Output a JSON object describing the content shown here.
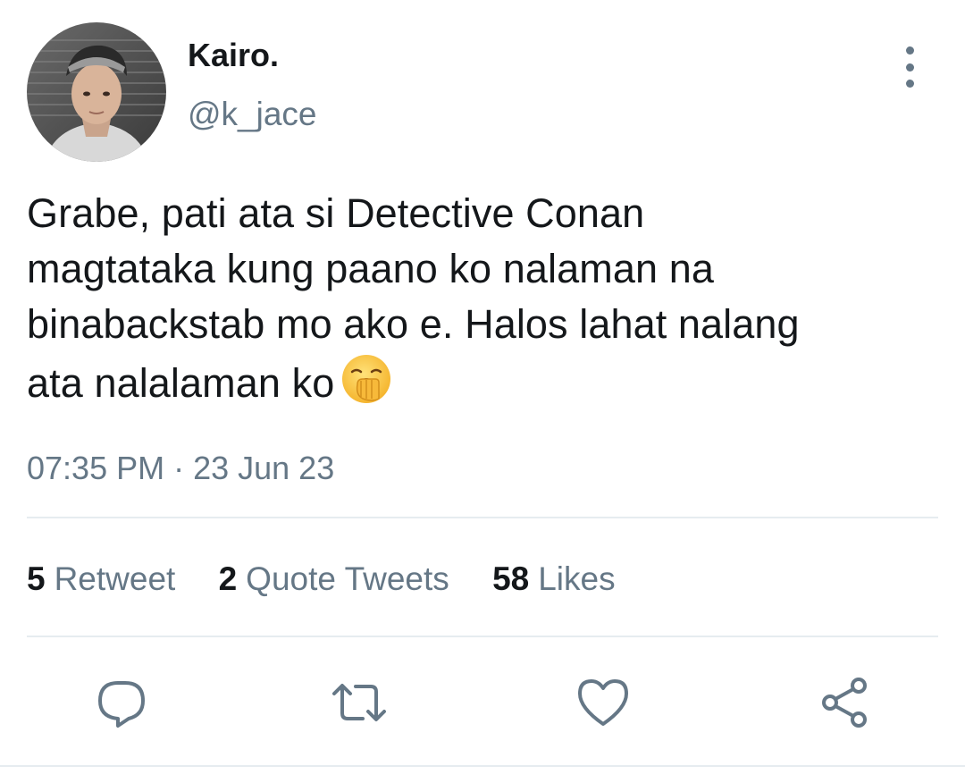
{
  "user": {
    "display_name": "Kairo.",
    "handle": "@k_jace"
  },
  "tweet": {
    "lines": [
      "Grabe, pati ata si Detective Conan",
      "magtataka kung paano ko nalaman na",
      "binabackstab mo ako e. Halos lahat nalang",
      "ata nalalaman ko"
    ],
    "emoji": "yawning-face-emoji",
    "timestamp": "07:35 PM · 23 Jun 23"
  },
  "stats": {
    "retweets": {
      "count": "5",
      "label": "Retweet"
    },
    "quotes": {
      "count": "2",
      "label": "Quote Tweets"
    },
    "likes": {
      "count": "58",
      "label": "Likes"
    }
  },
  "actions": [
    "reply-icon",
    "retweet-icon",
    "like-icon",
    "share-icon"
  ],
  "colors": {
    "text": "#14171a",
    "secondary": "#657786",
    "divider": "#e6ecf0"
  }
}
